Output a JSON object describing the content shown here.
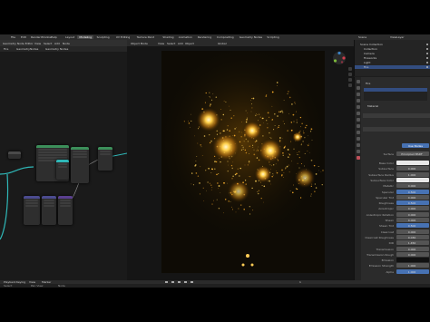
{
  "topbar": {
    "menus": [
      "File",
      "Edit",
      "Render",
      "Window",
      "Help"
    ],
    "workspaces": [
      "Layout",
      "Modeling",
      "Sculpting",
      "UV Editing",
      "Texture Paint",
      "Shading",
      "Animation",
      "Rendering",
      "Compositing",
      "Geometry Nodes",
      "Scripting"
    ],
    "active_workspace_index": 1,
    "scene": "Scene",
    "view_layer": "ViewLayer"
  },
  "node_editor": {
    "header": [
      "Geometry Node Editor",
      "View",
      "Select",
      "Add",
      "Node"
    ],
    "breadcrumb": [
      "Fire",
      "GeometryNodes",
      "Geometry Nodes"
    ],
    "accent_wire": "#2fb8b8"
  },
  "viewport": {
    "header": [
      "Object Mode",
      "View",
      "Select",
      "Add",
      "Object"
    ],
    "shading": "Global"
  },
  "outliner": {
    "items": [
      "Scene Collection",
      "Collection",
      "Camera",
      "Fireworks",
      "Light",
      "Fire"
    ],
    "selected_index": 5
  },
  "properties": {
    "object": "Fire",
    "material": "Material",
    "surface_button": "Use Nodes",
    "surface_label": "Surface",
    "surface_value": "Principled BSDF",
    "rows": [
      {
        "label": "Base Color",
        "value": "",
        "blue": false
      },
      {
        "label": "Subsurface",
        "value": "0.000",
        "blue": false
      },
      {
        "label": "Subsurface Radius",
        "value": "1.000",
        "blue": false
      },
      {
        "label": "Subsurface Color",
        "value": "",
        "blue": false
      },
      {
        "label": "Metallic",
        "value": "0.000",
        "blue": false
      },
      {
        "label": "Specular",
        "value": "0.500",
        "blue": true
      },
      {
        "label": "Specular Tint",
        "value": "0.000",
        "blue": false
      },
      {
        "label": "Roughness",
        "value": "0.500",
        "blue": true
      },
      {
        "label": "Anisotropic",
        "value": "0.000",
        "blue": false
      },
      {
        "label": "Anisotropic Rotation",
        "value": "0.000",
        "blue": false
      },
      {
        "label": "Sheen",
        "value": "0.000",
        "blue": false
      },
      {
        "label": "Sheen Tint",
        "value": "0.500",
        "blue": true
      },
      {
        "label": "Clearcoat",
        "value": "0.000",
        "blue": false
      },
      {
        "label": "Clearcoat Roughness",
        "value": "0.030",
        "blue": false
      },
      {
        "label": "IOR",
        "value": "1.450",
        "blue": false
      },
      {
        "label": "Transmission",
        "value": "0.000",
        "blue": false
      },
      {
        "label": "Transmission Rough",
        "value": "0.000",
        "blue": false
      },
      {
        "label": "Emission",
        "value": "",
        "blue": false
      },
      {
        "label": "Emission Strength",
        "value": "1.000",
        "blue": false
      },
      {
        "label": "Alpha",
        "value": "1.000",
        "blue": true
      }
    ]
  },
  "timeline": {
    "items": [
      "Playback",
      "Keying",
      "View",
      "Marker"
    ],
    "frame": "1"
  },
  "statusbar": {
    "items": [
      "Select",
      "Pan View",
      "Node"
    ]
  }
}
